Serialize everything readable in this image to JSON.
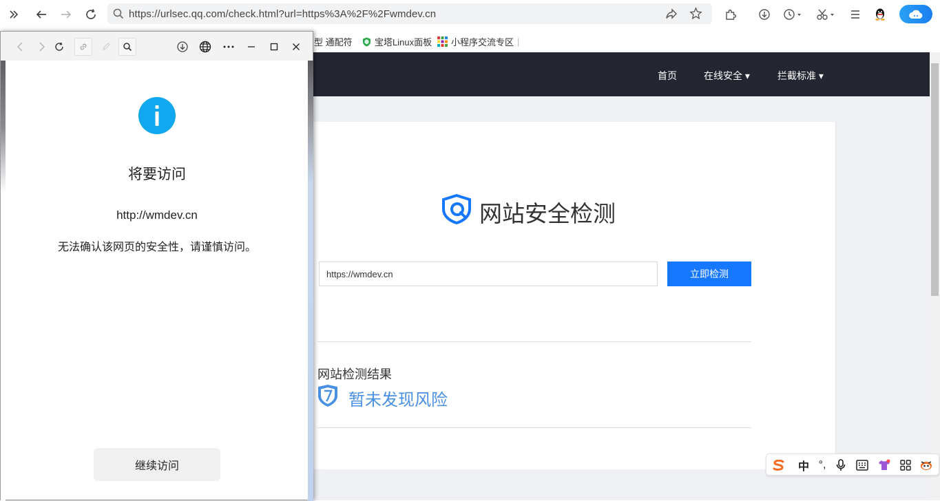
{
  "browser": {
    "url": "https://urlsec.qq.com/check.html?url=https%3A%2F%2Fwmdev.cn",
    "bookmarks": [
      {
        "label": "型 通配符",
        "icon": "bookmark-partial"
      },
      {
        "label": "宝塔Linux面板",
        "icon": "bt-shield-icon"
      },
      {
        "label": "小程序交流专区",
        "icon": "miniprogram-grid-icon"
      }
    ],
    "bookmark_sep": "|"
  },
  "site": {
    "nav": {
      "home": "首页",
      "online_security": "在线安全 ▾",
      "block_standard": "拦截标准 ▾"
    },
    "hero_title": "网站安全检测",
    "input_value": "https://wmdev.cn",
    "check_button": "立即检测",
    "result_title": "网站检测结果",
    "result_text": "暂未发现风险",
    "colors": {
      "nav_bg": "#232530",
      "accent": "#1677ff",
      "result": "#4a90e2"
    }
  },
  "ime": {
    "mode": "中",
    "punct": "°,"
  },
  "popup": {
    "title": "将要访问",
    "url": "http://wmdev.cn",
    "message": "无法确认该网页的安全性，请谨慎访问。",
    "continue_button": "继续访问",
    "info_color": "#12a8ef"
  }
}
